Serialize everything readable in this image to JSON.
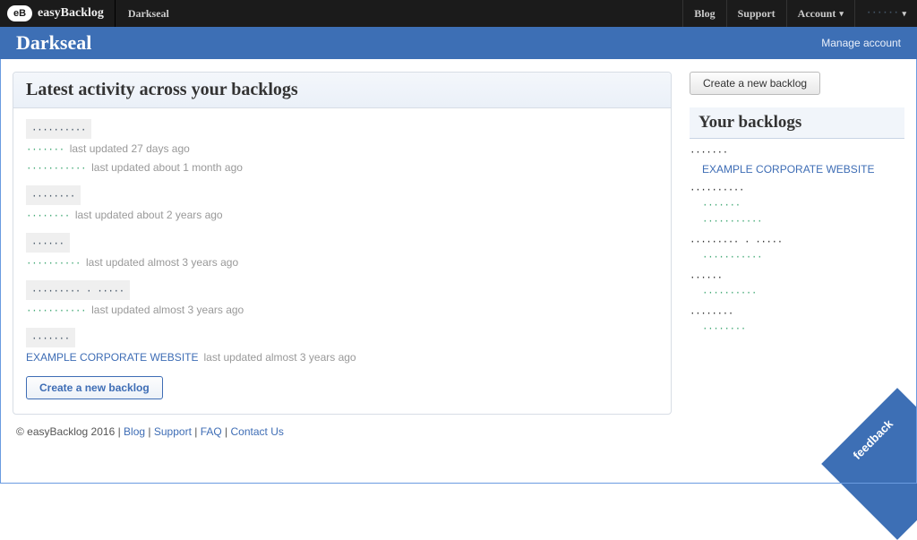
{
  "topbar": {
    "brand": "easyBacklog",
    "context": "Darkseal",
    "nav": {
      "blog": "Blog",
      "support": "Support",
      "account": "Account",
      "user": "······"
    }
  },
  "bluebar": {
    "title": "Darkseal",
    "manage": "Manage account"
  },
  "activity": {
    "heading": "Latest activity across your backlogs",
    "groups": [
      {
        "head": "··········",
        "items": [
          {
            "name": "·······",
            "ts": "last updated 27 days ago"
          },
          {
            "name": "···········",
            "ts": "last updated about 1 month ago"
          }
        ]
      },
      {
        "head": "········",
        "items": [
          {
            "name": "········",
            "ts": "last updated about 2 years ago"
          }
        ]
      },
      {
        "head": "······",
        "items": [
          {
            "name": "··········",
            "ts": "last updated almost 3 years ago"
          }
        ]
      },
      {
        "head": "········· · ·····",
        "items": [
          {
            "name": "···········",
            "ts": "last updated almost 3 years ago"
          }
        ]
      },
      {
        "head": "·······",
        "items": [
          {
            "name": "EXAMPLE CORPORATE WEBSITE",
            "ts": "last updated almost 3 years ago",
            "readable": true
          }
        ]
      }
    ],
    "create_btn": "Create a new backlog"
  },
  "sidebar": {
    "create_btn": "Create a new backlog",
    "heading": "Your backlogs",
    "groups": [
      {
        "head": "·······",
        "items": [
          "EXAMPLE CORPORATE WEBSITE"
        ],
        "readable": true
      },
      {
        "head": "··········",
        "items": [
          "·······",
          "···········"
        ]
      },
      {
        "head": "········· · ·····",
        "items": [
          "···········"
        ]
      },
      {
        "head": "······",
        "items": [
          "··········"
        ]
      },
      {
        "head": "········",
        "items": [
          "········"
        ]
      }
    ]
  },
  "footer": {
    "copyright": "© easyBacklog 2016",
    "blog": "Blog",
    "support": "Support",
    "faq": "FAQ",
    "contact": "Contact Us"
  },
  "feedback": "feedback"
}
